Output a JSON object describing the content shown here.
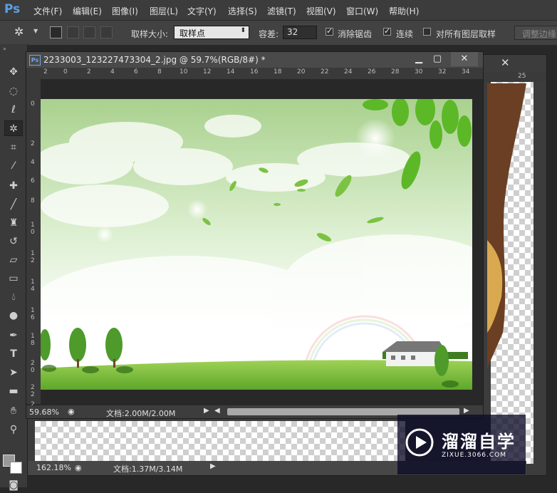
{
  "app": {
    "logo": "Ps"
  },
  "menu": [
    "文件(F)",
    "编辑(E)",
    "图像(I)",
    "图层(L)",
    "文字(Y)",
    "选择(S)",
    "滤镜(T)",
    "视图(V)",
    "窗口(W)",
    "帮助(H)"
  ],
  "options": {
    "sample_size_label": "取样大小:",
    "sample_size_value": "取样点",
    "tolerance_label": "容差:",
    "tolerance_value": "32",
    "anti_alias_label": "消除锯齿",
    "anti_alias_checked": true,
    "contiguous_label": "连续",
    "contiguous_checked": true,
    "sample_all_label": "对所有图层取样",
    "sample_all_checked": false,
    "refine_edge_label": "调整边缘"
  },
  "document_front": {
    "title": "2233003_123227473304_2.jpg @ 59.7%(RGB/8#) *",
    "zoom": "59.68%",
    "doc_info": "文档:2.00M/2.00M",
    "ruler_h": [
      "2",
      "0",
      "2",
      "4",
      "6",
      "8",
      "10",
      "12",
      "14",
      "16",
      "18",
      "20",
      "22",
      "24",
      "26",
      "28",
      "30",
      "32",
      "34"
    ],
    "ruler_v": [
      "0",
      "2",
      "4",
      "6",
      "8",
      "1 0",
      "1 2",
      "1 4",
      "1 6",
      "1 8",
      "2 0",
      "2 2",
      "2 4"
    ]
  },
  "document_back": {
    "zoom": "162.18%",
    "doc_info": "文档:1.37M/3.14M",
    "ruler_tick": "25"
  },
  "watermark": {
    "brand": "溜溜自学",
    "url": "ZIXUE.3066.COM"
  },
  "colors": {
    "accent": "#5aa0e6",
    "sky": "#a9d18e",
    "grass": "#7cc243"
  }
}
